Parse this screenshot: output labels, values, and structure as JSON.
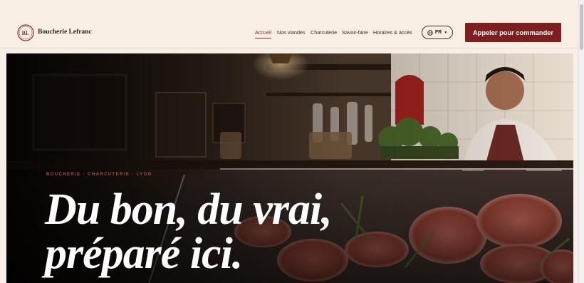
{
  "brand": {
    "monogram": "BL",
    "name": "Boucherie Lefranc",
    "accent": "#8a2a2a"
  },
  "nav": {
    "items": [
      {
        "label": "Accueil",
        "active": true
      },
      {
        "label": "Nos viandes",
        "active": false
      },
      {
        "label": "Charcuterie",
        "active": false
      },
      {
        "label": "Savoir-faire",
        "active": false
      },
      {
        "label": "Horaires & accès",
        "active": false
      }
    ]
  },
  "language": {
    "label": "FR",
    "icon": "globe-icon"
  },
  "cta": {
    "label": "Appeler pour commander",
    "color": "#7e1f1f"
  },
  "hero": {
    "kicker": "BOUCHERIE · CHARCUTERIE · LYON",
    "headline_line1": "Du bon, du vrai,",
    "headline_line2": "préparé ici."
  }
}
